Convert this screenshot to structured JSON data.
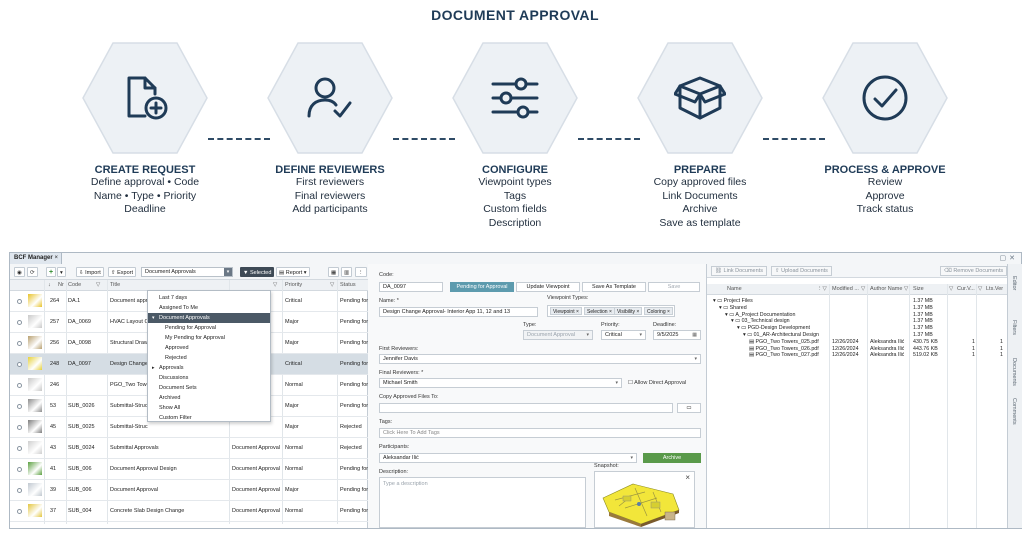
{
  "title": "DOCUMENT APPROVAL",
  "steps": [
    {
      "icon": "document-add-icon",
      "title": "CREATE REQUEST",
      "lines": [
        "Define approval • Code",
        "Name • Type • Priority",
        "Deadline"
      ]
    },
    {
      "icon": "user-check-icon",
      "title": "DEFINE REVIEWERS",
      "lines": [
        "First reviewers",
        "Final reviewers",
        "Add participants"
      ]
    },
    {
      "icon": "sliders-icon",
      "title": "CONFIGURE",
      "lines": [
        "Viewpoint types",
        "Tags",
        "Custom fields",
        "Description"
      ]
    },
    {
      "icon": "box-icon",
      "title": "PREPARE",
      "lines": [
        "Copy approved files",
        "Link Documents",
        "Archive",
        "Save as template"
      ]
    },
    {
      "icon": "check-circle-icon",
      "title": "PROCESS & APPROVE",
      "lines": [
        "Review",
        "Approve",
        "Track status"
      ]
    }
  ],
  "colors": {
    "navy": "#1f3b57",
    "hex_fill": "#edf1f5",
    "accent_teal": "#5d9bae",
    "archive_green": "#5a9a4a"
  },
  "app": {
    "tab_label": "BCF Manager",
    "toolbar": {
      "add": "+",
      "import": "Import",
      "export": "Export",
      "view_select": "Document Approvals",
      "selected": "Selected",
      "report": "Report"
    },
    "columns": {
      "nr": "Nr",
      "code": "Code",
      "title": "Title",
      "priority": "Priority",
      "status": "Status"
    },
    "rows": [
      {
        "nr": "264",
        "code": "DA.1",
        "title": "Document approval",
        "type": "",
        "priority": "Critical",
        "status": "Pending for"
      },
      {
        "nr": "257",
        "code": "DA_0069",
        "title": "HVAC Layout Ch",
        "type": "",
        "priority": "Major",
        "status": "Pending for"
      },
      {
        "nr": "256",
        "code": "DA_0098",
        "title": "Structural Drawi",
        "type": "",
        "priority": "Major",
        "status": "Pending for"
      },
      {
        "nr": "248",
        "code": "DA_0097",
        "title": "Design Change",
        "type": "",
        "priority": "Critical",
        "status": "Pending for"
      },
      {
        "nr": "246",
        "code": "",
        "title": "PGO_Two Tower",
        "type": "",
        "priority": "Normal",
        "status": "Pending for"
      },
      {
        "nr": "53",
        "code": "SUB_0026",
        "title": "Submittal-Struc",
        "type": "",
        "priority": "Major",
        "status": "Pending for"
      },
      {
        "nr": "45",
        "code": "SUB_0025",
        "title": "Submittal-Struc",
        "type": "",
        "priority": "Major",
        "status": "Rejected"
      },
      {
        "nr": "43",
        "code": "SUB_0024",
        "title": "Submittal Approvals",
        "type": "Document Approval",
        "priority": "Normal",
        "status": "Rejected"
      },
      {
        "nr": "41",
        "code": "SUB_006",
        "title": "Document Approval Design",
        "type": "Document Approval",
        "priority": "Normal",
        "status": "Pending for"
      },
      {
        "nr": "39",
        "code": "SUB_006",
        "title": "Document Approval",
        "type": "Document Approval",
        "priority": "Major",
        "status": "Pending for"
      },
      {
        "nr": "37",
        "code": "SUB_004",
        "title": "Concrete Slab Design Change",
        "type": "Document Approval",
        "priority": "Normal",
        "status": "Pending for"
      }
    ],
    "menu": [
      {
        "label": "Last 7 days",
        "level": 0,
        "arrow": ""
      },
      {
        "label": "Assigned To Me",
        "level": 0,
        "arrow": ""
      },
      {
        "label": "Document Approvals",
        "level": 0,
        "arrow": "▾",
        "highlight": true
      },
      {
        "label": "Pending for Approval",
        "level": 1,
        "arrow": ""
      },
      {
        "label": "My Pending for Approval",
        "level": 1,
        "arrow": ""
      },
      {
        "label": "Approved",
        "level": 1,
        "arrow": ""
      },
      {
        "label": "Rejected",
        "level": 1,
        "arrow": ""
      },
      {
        "label": "Approvals",
        "level": 0,
        "arrow": "▸"
      },
      {
        "label": "Discussions",
        "level": 0,
        "arrow": ""
      },
      {
        "label": "Document Sets",
        "level": 0,
        "arrow": ""
      },
      {
        "label": "Archived",
        "level": 0,
        "arrow": ""
      },
      {
        "label": "Show All",
        "level": 0,
        "arrow": ""
      },
      {
        "label": "Custom Filter",
        "level": 0,
        "arrow": ""
      }
    ],
    "form": {
      "code_label": "Code:",
      "code_value": "DA_0097",
      "status_button": "Pending for Approval",
      "update_viewpoint": "Update Viewpoint",
      "save_template": "Save As Template",
      "save": "Save",
      "name_label": "Name: *",
      "name_value": "Design Change Approval- Interior App 11, 12 and 13",
      "viewpoint_types_label": "Viewpoint Types:",
      "viewpoint_chips": [
        "Viewpoint ×",
        "Selection ×",
        "Visibility ×",
        "Coloring ×"
      ],
      "type_label": "Type:",
      "type_value": "Document Approval",
      "priority_label": "Priority:",
      "priority_value": "Critical",
      "deadline_label": "Deadline:",
      "deadline_value": "9/5/2025",
      "first_reviewers_label": "First Reviewers:",
      "first_reviewers_value": "Jennifer Davis",
      "final_reviewers_label": "Final Reviewers: *",
      "final_reviewers_value": "Michael Smith",
      "allow_direct": "Allow Direct Approval",
      "copy_files_label": "Copy Approved Files To:",
      "tags_label": "Tags:",
      "tags_placeholder": "Click Here To Add Tags",
      "participants_label": "Participants:",
      "participants_value": "Aleksandar Ilić",
      "archive": "Archive",
      "description_label": "Description:",
      "description_placeholder": "Type a description",
      "snapshot_label": "Snapshot:"
    },
    "docs": {
      "link": "Link Documents",
      "upload": "Upload Documents",
      "remove": "Remove Documents",
      "columns": {
        "name": "Name",
        "modified": "Modified ...",
        "author": "Author Name",
        "size": "Size",
        "cur": "Cur.V...",
        "lts": "Lts.Ver"
      },
      "tree": [
        {
          "label": "Project Files",
          "level": 0,
          "kind": "folder",
          "modified": "",
          "author": "",
          "size": "1.37 MB",
          "cur": "",
          "lts": ""
        },
        {
          "label": "Shared",
          "level": 1,
          "kind": "folder",
          "modified": "",
          "author": "",
          "size": "1.37 MB",
          "cur": "",
          "lts": ""
        },
        {
          "label": "A_Project Documentation",
          "level": 2,
          "kind": "folder",
          "modified": "",
          "author": "",
          "size": "1.37 MB",
          "cur": "",
          "lts": ""
        },
        {
          "label": "03_Technical design",
          "level": 3,
          "kind": "folder",
          "modified": "",
          "author": "",
          "size": "1.37 MB",
          "cur": "",
          "lts": ""
        },
        {
          "label": "PGD-Design Development",
          "level": 4,
          "kind": "folder",
          "modified": "",
          "author": "",
          "size": "1.37 MB",
          "cur": "",
          "lts": ""
        },
        {
          "label": "01_AR-Architectural Design",
          "level": 5,
          "kind": "folder",
          "modified": "",
          "author": "",
          "size": "1.37 MB",
          "cur": "",
          "lts": ""
        },
        {
          "label": "PGO_Two Towers_025.pdf",
          "level": 6,
          "kind": "file",
          "modified": "12/26/2024",
          "author": "Aleksandra Ilić",
          "size": "430.75 KB",
          "cur": "1",
          "lts": "1"
        },
        {
          "label": "PGO_Two Towers_026.pdf",
          "level": 6,
          "kind": "file",
          "modified": "12/26/2024",
          "author": "Aleksandra Ilić",
          "size": "443.76 KB",
          "cur": "1",
          "lts": "1"
        },
        {
          "label": "PGO_Two Towers_027.pdf",
          "level": 6,
          "kind": "file",
          "modified": "12/26/2024",
          "author": "Aleksandra Ilić",
          "size": "519.02 KB",
          "cur": "1",
          "lts": "1"
        }
      ]
    },
    "side_tabs": [
      "Editor",
      "Filters",
      "Documents",
      "Comments"
    ]
  }
}
